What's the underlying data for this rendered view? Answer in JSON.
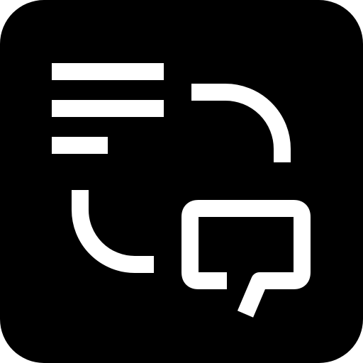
{
  "icon": {
    "name": "conversation-icon",
    "background_color": "#000000",
    "foreground_color": "#ffffff",
    "glyphs": [
      "text-lines-icon",
      "arc-arrow-icon",
      "speech-bubble-icon"
    ]
  }
}
